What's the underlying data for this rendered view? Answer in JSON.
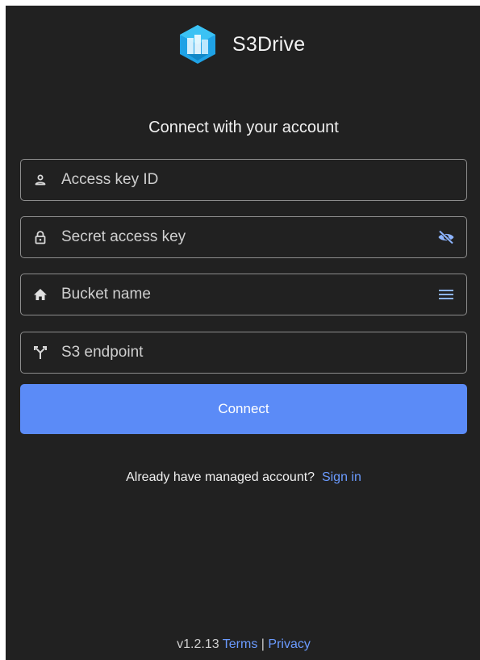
{
  "app": {
    "name": "S3Drive",
    "logo_icon": "s3drive-logo-icon",
    "accent_color": "#5b8bf7",
    "background_color": "#212121"
  },
  "heading": "Connect with your account",
  "fields": [
    {
      "placeholder": "Access key ID",
      "value": "",
      "icon": "person-icon"
    },
    {
      "placeholder": "Secret access key",
      "value": "",
      "icon": "lock-icon",
      "trailing_icon": "eye-off-icon"
    },
    {
      "placeholder": "Bucket name",
      "value": "",
      "icon": "home-icon",
      "trailing_icon": "menu-icon"
    },
    {
      "placeholder": "S3 endpoint",
      "value": "",
      "icon": "fork-icon"
    }
  ],
  "connect_label": "Connect",
  "signin": {
    "prompt": "Already have managed account?",
    "link": "Sign in"
  },
  "footer": {
    "version": "v1.2.13",
    "terms": "Terms",
    "separator": "|",
    "privacy": "Privacy"
  }
}
